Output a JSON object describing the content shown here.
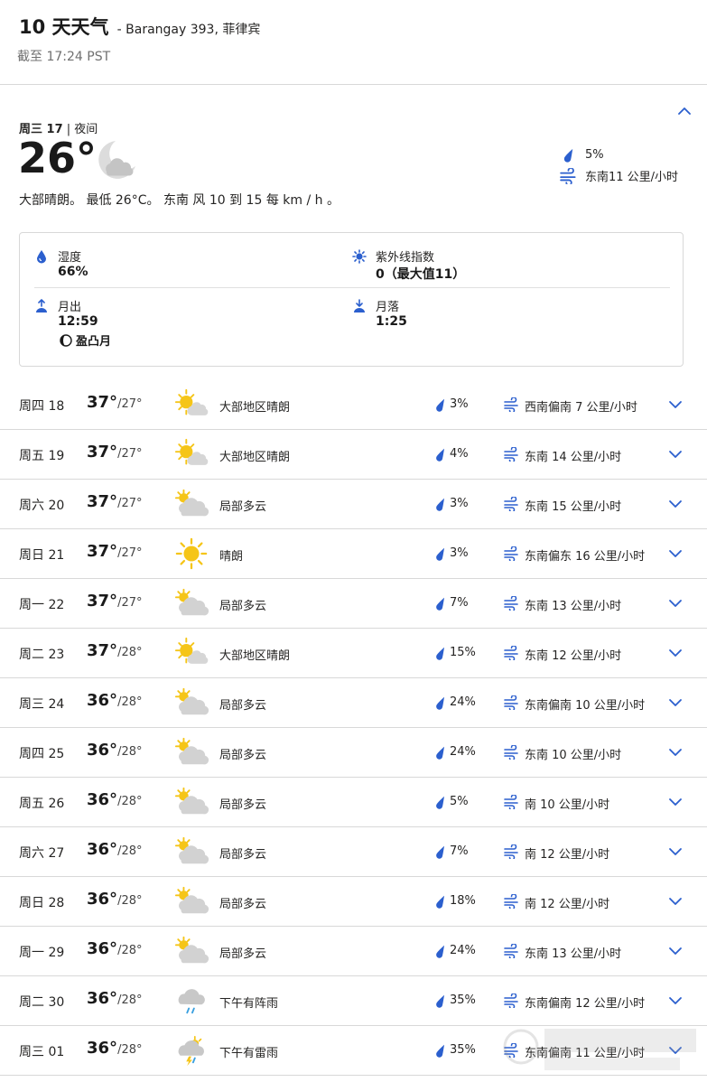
{
  "header": {
    "title": "10 天天气",
    "location": "- Barangay 393, 菲律宾",
    "as_of": "截至 17:24 PST"
  },
  "today": {
    "day": "周三 17",
    "period": "| 夜间",
    "temp": "26°",
    "icon": "crescent-moon-cloud-icon",
    "precip": "5%",
    "wind": "东南11 公里/小时",
    "description": "大部晴朗。 最低 26°C。 东南 风 10 到 15 每 km / h 。",
    "details": {
      "humidity_label": "湿度",
      "humidity_value": "66%",
      "uv_label": "紫外线指数",
      "uv_value": "0（最大值11）",
      "moonrise_label": "月出",
      "moonrise_value": "12:59",
      "moonset_label": "月落",
      "moonset_value": "1:25",
      "moon_phase": "盈凸月"
    }
  },
  "colors": {
    "accent": "#2b5fce",
    "sun": "#f5c518",
    "cloud": "#cfcfcf"
  },
  "forecast": [
    {
      "day": "周四 18",
      "hi": "37°",
      "lo": "/27°",
      "icon": "mostly-sunny-icon",
      "condition": "大部地区晴朗",
      "precip": "3%",
      "wind": "西南偏南 7 公里/小时"
    },
    {
      "day": "周五 19",
      "hi": "37°",
      "lo": "/27°",
      "icon": "mostly-sunny-icon",
      "condition": "大部地区晴朗",
      "precip": "4%",
      "wind": "东南 14 公里/小时"
    },
    {
      "day": "周六 20",
      "hi": "37°",
      "lo": "/27°",
      "icon": "partly-cloudy-icon",
      "condition": "局部多云",
      "precip": "3%",
      "wind": "东南 15 公里/小时"
    },
    {
      "day": "周日 21",
      "hi": "37°",
      "lo": "/27°",
      "icon": "sunny-icon",
      "condition": "晴朗",
      "precip": "3%",
      "wind": "东南偏东 16 公里/小时"
    },
    {
      "day": "周一 22",
      "hi": "37°",
      "lo": "/27°",
      "icon": "partly-cloudy-icon",
      "condition": "局部多云",
      "precip": "7%",
      "wind": "东南 13 公里/小时"
    },
    {
      "day": "周二 23",
      "hi": "37°",
      "lo": "/28°",
      "icon": "mostly-sunny-icon",
      "condition": "大部地区晴朗",
      "precip": "15%",
      "wind": "东南 12 公里/小时"
    },
    {
      "day": "周三 24",
      "hi": "36°",
      "lo": "/28°",
      "icon": "partly-cloudy-icon",
      "condition": "局部多云",
      "precip": "24%",
      "wind": "东南偏南 10 公里/小时"
    },
    {
      "day": "周四 25",
      "hi": "36°",
      "lo": "/28°",
      "icon": "partly-cloudy-icon",
      "condition": "局部多云",
      "precip": "24%",
      "wind": "东南 10 公里/小时"
    },
    {
      "day": "周五 26",
      "hi": "36°",
      "lo": "/28°",
      "icon": "partly-cloudy-icon",
      "condition": "局部多云",
      "precip": "5%",
      "wind": "南 10 公里/小时"
    },
    {
      "day": "周六 27",
      "hi": "36°",
      "lo": "/28°",
      "icon": "partly-cloudy-icon",
      "condition": "局部多云",
      "precip": "7%",
      "wind": "南 12 公里/小时"
    },
    {
      "day": "周日 28",
      "hi": "36°",
      "lo": "/28°",
      "icon": "partly-cloudy-icon",
      "condition": "局部多云",
      "precip": "18%",
      "wind": "南 12 公里/小时"
    },
    {
      "day": "周一 29",
      "hi": "36°",
      "lo": "/28°",
      "icon": "partly-cloudy-icon",
      "condition": "局部多云",
      "precip": "24%",
      "wind": "东南 13 公里/小时"
    },
    {
      "day": "周二 30",
      "hi": "36°",
      "lo": "/28°",
      "icon": "afternoon-showers-icon",
      "condition": "下午有阵雨",
      "precip": "35%",
      "wind": "东南偏南 12 公里/小时"
    },
    {
      "day": "周三 01",
      "hi": "36°",
      "lo": "/28°",
      "icon": "afternoon-thunderstorms-icon",
      "condition": "下午有雷雨",
      "precip": "35%",
      "wind": "东南偏南 11 公里/小时"
    }
  ]
}
